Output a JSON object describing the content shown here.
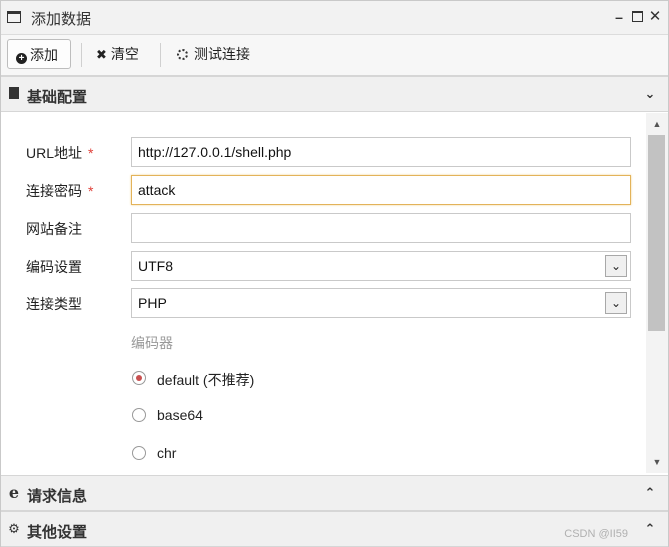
{
  "window": {
    "title": "添加数据"
  },
  "toolbar": {
    "add_label": "添加",
    "clear_label": "清空",
    "test_label": "测试连接"
  },
  "sections": {
    "basic": {
      "label": "基础配置"
    },
    "request": {
      "label": "请求信息"
    },
    "other": {
      "label": "其他设置"
    }
  },
  "form": {
    "url": {
      "label": "URL地址",
      "required": "*",
      "value": "http://127.0.0.1/shell.php"
    },
    "password": {
      "label": "连接密码",
      "required": "*",
      "value": "attack"
    },
    "note": {
      "label": "网站备注",
      "value": ""
    },
    "encoding": {
      "label": "编码设置",
      "value": "UTF8"
    },
    "type": {
      "label": "连接类型",
      "value": "PHP"
    },
    "encoder": {
      "title": "编码器",
      "options": [
        {
          "label": "default (不推荐)",
          "checked": true
        },
        {
          "label": "base64",
          "checked": false
        },
        {
          "label": "chr",
          "checked": false
        }
      ]
    }
  },
  "watermark": "CSDN @II59",
  "colors": {
    "required": "#e0413a",
    "focus_border": "#e3b35a"
  }
}
